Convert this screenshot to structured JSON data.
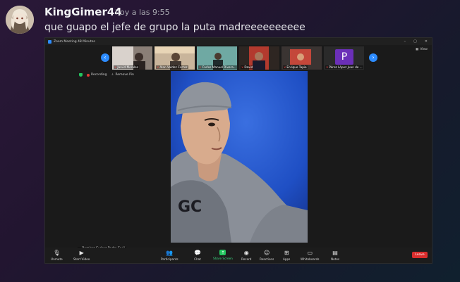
{
  "message": {
    "username": "KingGimer44",
    "timestamp": "hoy a las 9:55",
    "text": "que guapo el jefe de grupo la puta madreeeeeeeeee"
  },
  "zoom": {
    "window_title": "Zoom Meeting 48 Minutes",
    "view_label": "View",
    "participants_strip": [
      {
        "name": "Jarvid Morales"
      },
      {
        "name": "Alan Valdez Cortez"
      },
      {
        "name": "Carlos Manuel Rivera..."
      },
      {
        "name": "David"
      },
      {
        "name": "Enrique Tapia"
      },
      {
        "name": "Pérez López Juan de ...",
        "initial": "P"
      }
    ],
    "status": {
      "recording": "Recording",
      "remove_pin": "Remove Pin"
    },
    "active_speaker_name": "Ramírez Suárez Pedro Saúl",
    "toolbar": {
      "unmute": "Unmute",
      "start_video": "Start Video",
      "participants": "Participants",
      "participants_count": "10",
      "chat": "Chat",
      "share_screen": "Share Screen",
      "record": "Record",
      "reactions": "Reactions",
      "apps": "Apps",
      "whiteboards": "Whiteboards",
      "notes": "Notes",
      "leave": "Leave"
    },
    "colors": {
      "accent_blue": "#2d8cff",
      "share_green": "#22c55e",
      "leave_red": "#d92d2d",
      "avatar_purple": "#6b2fb8"
    }
  }
}
